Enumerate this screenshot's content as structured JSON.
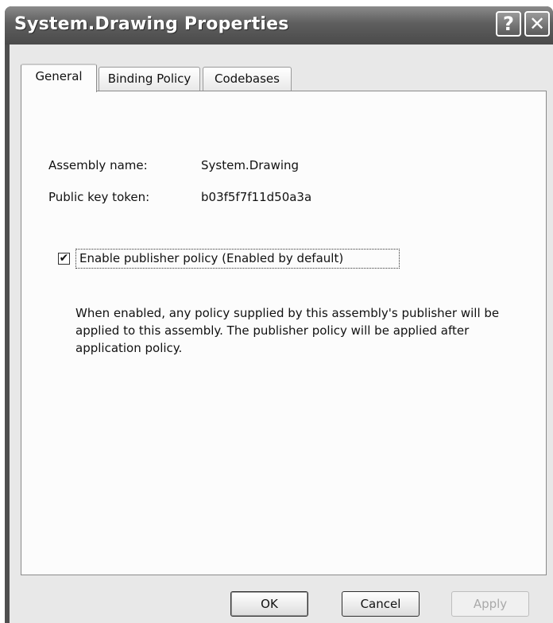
{
  "window": {
    "title": "System.Drawing Properties",
    "help_glyph": "?",
    "close_glyph": "✕"
  },
  "tabs": [
    {
      "label": "General",
      "active": true
    },
    {
      "label": "Binding Policy",
      "active": false
    },
    {
      "label": "Codebases",
      "active": false
    }
  ],
  "general": {
    "assembly_name_label": "Assembly name:",
    "assembly_name_value": "System.Drawing",
    "public_key_label": "Public key token:",
    "public_key_value": "b03f5f7f11d50a3a",
    "publisher_policy_checkbox": {
      "label": "Enable publisher policy (Enabled by default)",
      "checked": true,
      "check_glyph": "✔"
    },
    "description": "When enabled, any policy supplied by this assembly's publisher will be applied to this assembly.  The publisher policy will be applied after application policy."
  },
  "buttons": {
    "ok": "OK",
    "cancel": "Cancel",
    "apply": "Apply"
  }
}
